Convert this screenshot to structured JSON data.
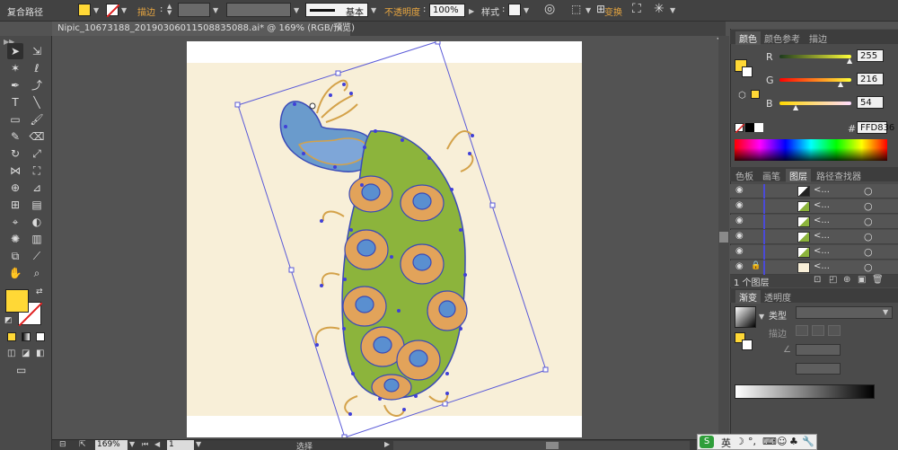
{
  "control_bar": {
    "object_type": "复合路径",
    "fill_color": "#ffd836",
    "stroke_label": "描边",
    "brush_label": "基本",
    "opacity_label": "不透明度",
    "opacity_value": "100%",
    "style_label": "样式",
    "transform_label": "变换"
  },
  "document_tab": {
    "title": "Nipic_10673188_20190306011508835088.ai* @ 169% (RGB/预览)",
    "close_glyph": "×"
  },
  "color_panel": {
    "tabs": [
      "颜色",
      "颜色参考",
      "描边"
    ],
    "active_tab": 0,
    "channels": [
      {
        "label": "R",
        "value": "255",
        "fraction": 0.98,
        "gradient": [
          "#1d3a1d",
          "#ffff3a"
        ]
      },
      {
        "label": "G",
        "value": "216",
        "fraction": 0.85,
        "gradient": [
          "#ff0000",
          "#ffff3a"
        ]
      },
      {
        "label": "B",
        "value": "54",
        "fraction": 0.21,
        "gradient": [
          "#ffd800",
          "#ffdcff"
        ]
      }
    ],
    "hex_label": "#",
    "hex_value": "FFD836"
  },
  "layers_panel": {
    "tabs": [
      "色板",
      "画笔",
      "图层",
      "路径查找器"
    ],
    "active_tab": 2,
    "rows": [
      {
        "name": "<...",
        "thumb": "dark"
      },
      {
        "name": "<...",
        "thumb": "green"
      },
      {
        "name": "<...",
        "thumb": "green"
      },
      {
        "name": "<...",
        "thumb": "green"
      },
      {
        "name": "<...",
        "thumb": "green"
      },
      {
        "name": "<...",
        "thumb": "cream",
        "locked": true
      }
    ],
    "layer_count": "1 个图层"
  },
  "gradient_panel": {
    "tabs": [
      "渐变",
      "透明度"
    ],
    "active_tab": 0,
    "type_label": "类型",
    "stroke_label": "描边"
  },
  "status_bar": {
    "zoom": "169%",
    "page": "1",
    "tool_name": "选择"
  },
  "colors": {
    "ui_bg": "#535353",
    "panel_bg": "#4b4b4b",
    "accent_orange": "#e8a640",
    "fill_yellow": "#ffd836",
    "peacock_green": "#8cb43c",
    "peacock_blue": "#5a8fd0",
    "peacock_orange": "#e2a35a",
    "selection_blue": "#4040d8"
  }
}
